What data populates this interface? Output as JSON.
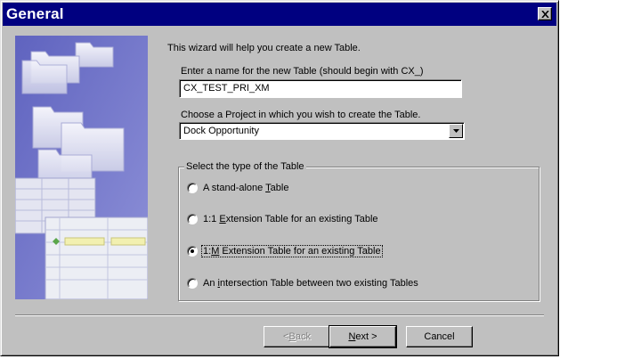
{
  "window": {
    "title": "General"
  },
  "intro": "This wizard will help you create a new Table.",
  "name_field": {
    "label": "Enter a name for the new Table (should begin with CX_)",
    "value": "CX_TEST_PRI_XM"
  },
  "project_field": {
    "label": "Choose a Project in which you wish to create the Table.",
    "value": "Dock Opportunity"
  },
  "table_type": {
    "legend": "Select the type of the Table",
    "selected_index": 2,
    "options": [
      {
        "pre": "A stand-alone ",
        "key": "T",
        "post": "able",
        "checked": false
      },
      {
        "pre": "1:1 ",
        "key": "E",
        "post": "xtension Table for an existing Table",
        "checked": false
      },
      {
        "pre": "1:",
        "key": "M",
        "post": " Extension Table for an existing Table",
        "checked": true
      },
      {
        "pre": "An ",
        "key": "i",
        "post": "ntersection Table between two existing Tables",
        "checked": false
      }
    ]
  },
  "buttons": {
    "back": {
      "pre": "< ",
      "key": "B",
      "post": "ack",
      "enabled": false
    },
    "next": {
      "pre": "",
      "key": "N",
      "post": "ext >",
      "enabled": true
    },
    "cancel": {
      "label": "Cancel",
      "enabled": true
    }
  },
  "icons": {
    "close": "close-icon",
    "dropdown": "dropdown-arrow-icon",
    "illustration": "wizard-illustration"
  }
}
